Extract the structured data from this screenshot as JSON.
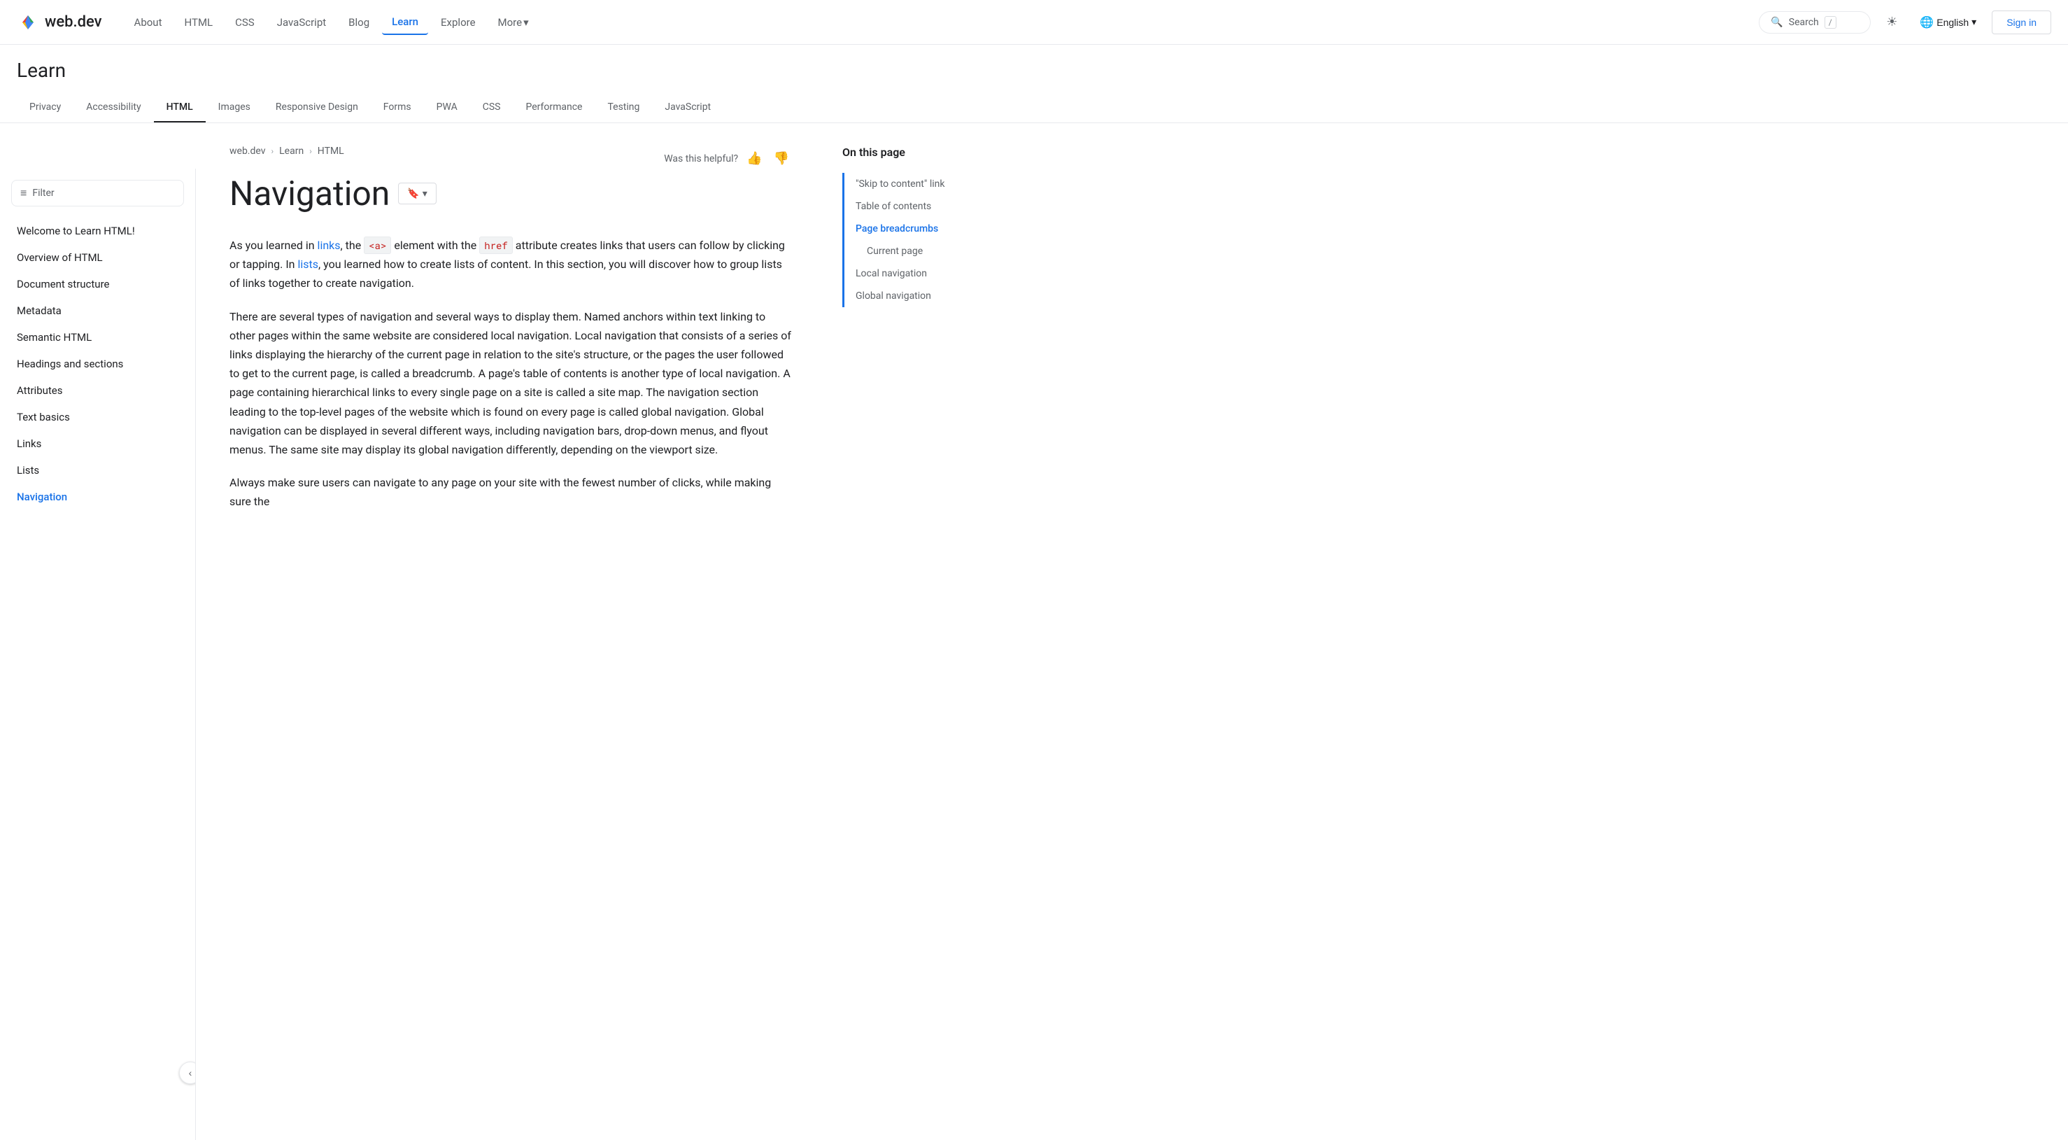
{
  "site": {
    "logo_text": "web.dev",
    "logo_icon_colors": [
      "#4285f4",
      "#ea4335",
      "#fbbc04",
      "#34a853"
    ]
  },
  "top_nav": {
    "links": [
      {
        "label": "About",
        "active": false
      },
      {
        "label": "HTML",
        "active": false
      },
      {
        "label": "CSS",
        "active": false
      },
      {
        "label": "JavaScript",
        "active": false
      },
      {
        "label": "Blog",
        "active": false
      },
      {
        "label": "Learn",
        "active": true
      },
      {
        "label": "Explore",
        "active": false
      },
      {
        "label": "More",
        "active": false,
        "has_chevron": true
      }
    ],
    "search_placeholder": "Search",
    "search_slash": "/",
    "theme_icon": "☀",
    "language_label": "English",
    "signin_label": "Sign in"
  },
  "learn_header": {
    "title": "Learn",
    "tabs": [
      {
        "label": "Privacy",
        "active": false
      },
      {
        "label": "Accessibility",
        "active": false
      },
      {
        "label": "HTML",
        "active": true
      },
      {
        "label": "Images",
        "active": false
      },
      {
        "label": "Responsive Design",
        "active": false
      },
      {
        "label": "Forms",
        "active": false
      },
      {
        "label": "PWA",
        "active": false
      },
      {
        "label": "CSS",
        "active": false
      },
      {
        "label": "Performance",
        "active": false
      },
      {
        "label": "Testing",
        "active": false
      },
      {
        "label": "JavaScript",
        "active": false
      }
    ]
  },
  "sidebar": {
    "filter_label": "Filter",
    "items": [
      {
        "label": "Welcome to Learn HTML!",
        "active": false
      },
      {
        "label": "Overview of HTML",
        "active": false
      },
      {
        "label": "Document structure",
        "active": false
      },
      {
        "label": "Metadata",
        "active": false
      },
      {
        "label": "Semantic HTML",
        "active": false
      },
      {
        "label": "Headings and sections",
        "active": false
      },
      {
        "label": "Attributes",
        "active": false
      },
      {
        "label": "Text basics",
        "active": false
      },
      {
        "label": "Links",
        "active": false
      },
      {
        "label": "Lists",
        "active": false
      },
      {
        "label": "Navigation",
        "active": true
      }
    ],
    "collapse_icon": "‹"
  },
  "breadcrumb": {
    "items": [
      {
        "label": "web.dev"
      },
      {
        "label": "Learn"
      },
      {
        "label": "HTML"
      }
    ]
  },
  "page": {
    "title": "Navigation",
    "bookmark_label": "▾",
    "helpful_question": "Was this helpful?",
    "paragraphs": [
      "As you learned in links, the <a> element with the href attribute creates links that users can follow by clicking or tapping. In lists, you learned how to create lists of content. In this section, you will discover how to group lists of links together to create navigation.",
      "There are several types of navigation and several ways to display them. Named anchors within text linking to other pages within the same website are considered local navigation. Local navigation that consists of a series of links displaying the hierarchy of the current page in relation to the site's structure, or the pages the user followed to get to the current page, is called a breadcrumb. A page's table of contents is another type of local navigation. A page containing hierarchical links to every single page on a site is called a site map. The navigation section leading to the top-level pages of the website which is found on every page is called global navigation. Global navigation can be displayed in several different ways, including navigation bars, drop-down menus, and flyout menus. The same site may display its global navigation differently, depending on the viewport size.",
      "Always make sure users can navigate to any page on your site with the fewest number of clicks, while making sure the"
    ],
    "inline_links": [
      {
        "text": "links",
        "href": "#"
      },
      {
        "text": "lists",
        "href": "#"
      }
    ],
    "inline_code": [
      {
        "text": "<a>"
      },
      {
        "text": "href"
      }
    ]
  },
  "on_this_page": {
    "title": "On this page",
    "items": [
      {
        "label": "\"Skip to content\" link",
        "active": false,
        "sub": false
      },
      {
        "label": "Table of contents",
        "active": false,
        "sub": false
      },
      {
        "label": "Page breadcrumbs",
        "active": true,
        "sub": false
      },
      {
        "label": "Current page",
        "active": false,
        "sub": true
      },
      {
        "label": "Local navigation",
        "active": false,
        "sub": false
      },
      {
        "label": "Global navigation",
        "active": false,
        "sub": false
      }
    ]
  }
}
